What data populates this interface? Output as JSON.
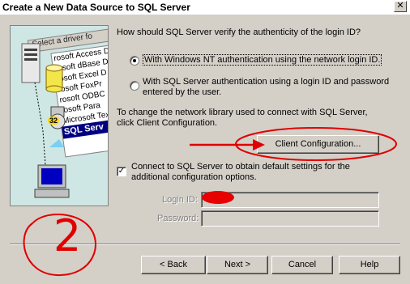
{
  "window": {
    "title": "Create a New Data Source to SQL Server",
    "close_glyph": "✕"
  },
  "illustration": {
    "header_text": "Select a driver fo",
    "drivers": [
      "rosoft Access D",
      "rosoft dBase D",
      "rosoft Excel D",
      "rosoft FoxPr",
      "rosoft ODBC",
      "rosoft Para",
      "Microsoft Tex"
    ],
    "selected_driver": "SQL Serv",
    "badge": "32"
  },
  "auth": {
    "question": "How should SQL Server verify the authenticity of the login ID?",
    "options": [
      {
        "label": "With Windows NT authentication using the network login ID.",
        "selected": true
      },
      {
        "label_line1": "With SQL Server authentication using a login ID and password",
        "label_line2": "entered by the user.",
        "selected": false
      }
    ]
  },
  "network": {
    "info_line1": "To change the network library used to connect with SQL Server,",
    "info_line2": "click Client Configuration.",
    "client_config_button": "Client Configuration..."
  },
  "connect": {
    "checked": true,
    "label_line1": "Connect to SQL Server to obtain default settings for the",
    "label_line2": "additional configuration options."
  },
  "login": {
    "login_id_label": "Login ID:",
    "login_id_value": "",
    "password_label": "Password:",
    "password_value": ""
  },
  "footer": {
    "back_button": "< Back",
    "next_button": "Next >",
    "cancel_button": "Cancel",
    "help_button": "Help"
  },
  "annotation": {
    "number": "2",
    "color": "#e00000"
  }
}
